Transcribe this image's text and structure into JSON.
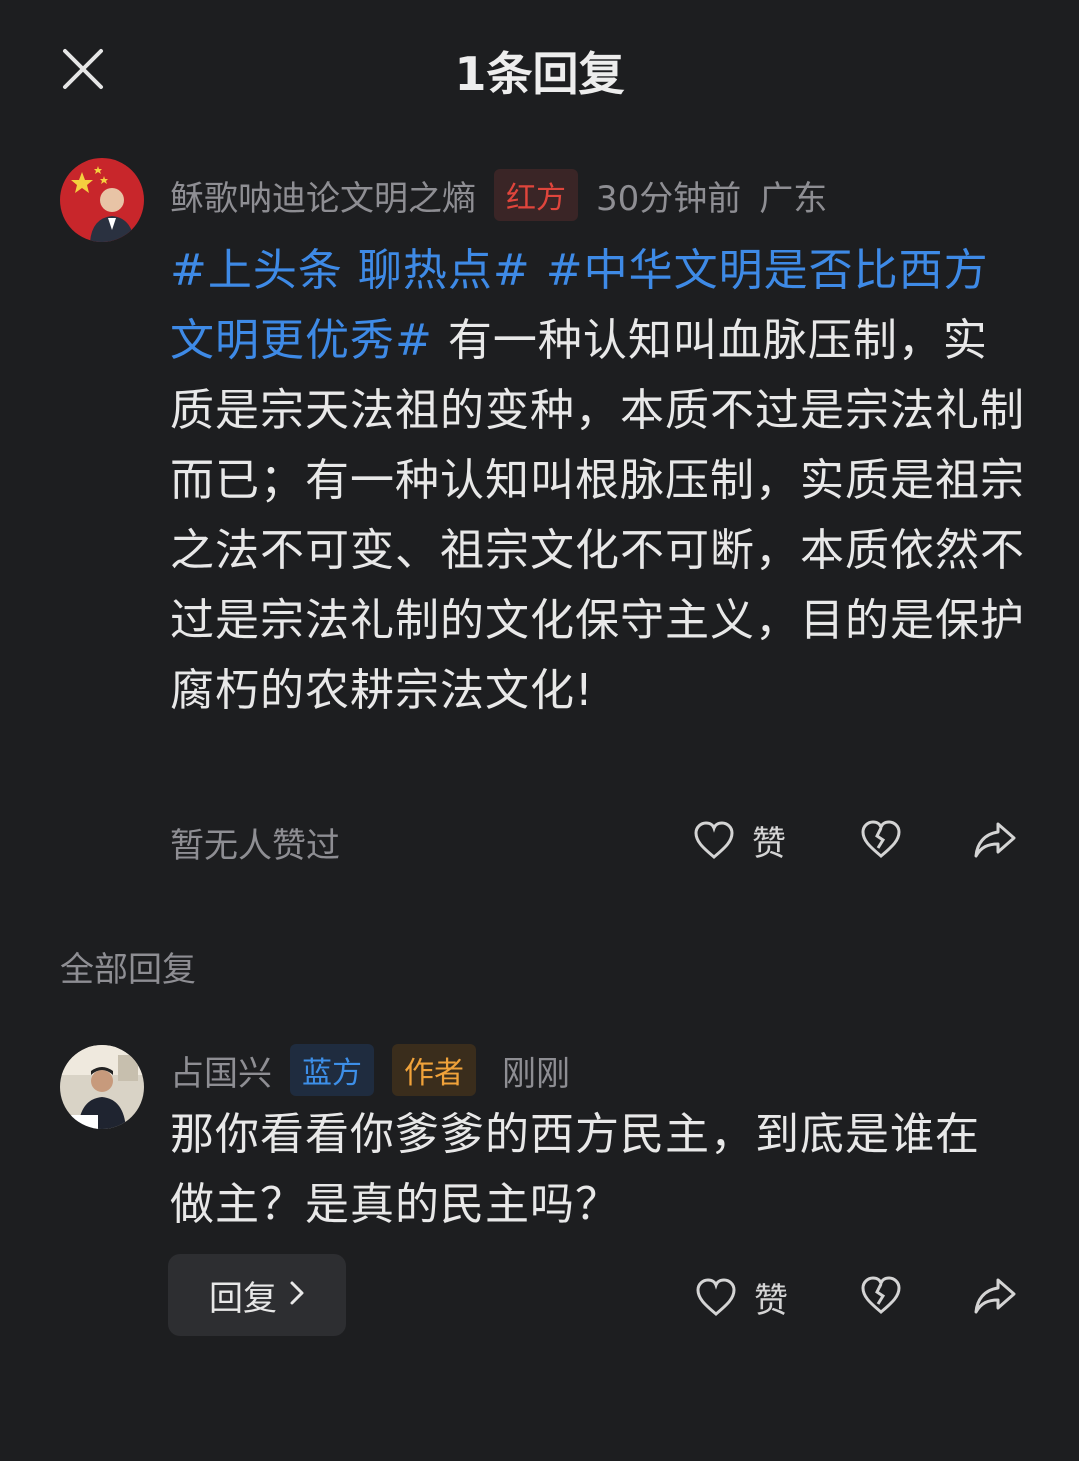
{
  "header": {
    "title": "1条回复"
  },
  "main_comment": {
    "username": "稣歌呐迪论文明之熵",
    "tag": "红方",
    "time": "30分钟前",
    "location": "广东",
    "hashtag1": "#上头条 聊热点#",
    "hashtag2": "#中华文明是否比西方文明更优秀#",
    "text": "有一种认知叫血脉压制，实质是宗天法祖的变种，本质不过是宗法礼制而已；有一种认知叫根脉压制，实质是祖宗之法不可变、祖宗文化不可断，本质依然不过是宗法礼制的文化保守主义，目的是保护腐朽的农耕宗法文化!",
    "likes_status": "暂无人赞过",
    "like_label": "赞"
  },
  "section": {
    "all_replies": "全部回复"
  },
  "reply": {
    "username": "占国兴",
    "tag_side": "蓝方",
    "tag_author": "作者",
    "time": "刚刚",
    "text": "那你看看你爹爹的西方民主，到底是谁在做主？是真的民主吗？",
    "like_label": "赞",
    "reply_button": "回复"
  },
  "colors": {
    "background": "#1d1e20",
    "hashtag": "#3e8ae6",
    "tag_red": "#e0453c",
    "tag_blue": "#3d8fe8",
    "tag_orange": "#f0a23a"
  }
}
